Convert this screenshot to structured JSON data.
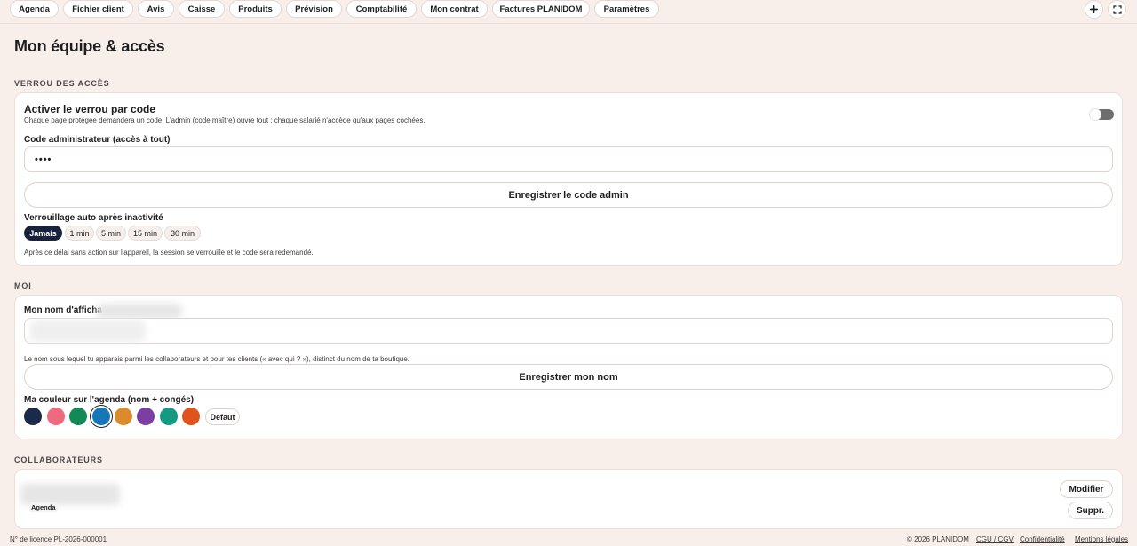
{
  "nav": {
    "tabs": [
      "Agenda",
      "Fichier client",
      "Avis",
      "Caisse",
      "Produits",
      "Prévision",
      "Comptabilité",
      "Mon contrat",
      "Factures PLANIDOM",
      "Paramètres"
    ],
    "plus_icon": "plus-icon",
    "expand_icon": "expand-icon"
  },
  "page": {
    "title": "Mon équipe & accès"
  },
  "lock_section": {
    "label": "VERROU DES ACCÈS",
    "toggle_title": "Activer le verrou par code",
    "toggle_desc": "Chaque page protégée demandera un code. L'admin (code maître) ouvre tout ; chaque salarié n'accède qu'aux pages cochées.",
    "toggle_on": false,
    "admin_code_label": "Code administrateur (accès à tout)",
    "admin_code_value": "••••",
    "save_admin_button": "Enregistrer le code admin",
    "autolock_label": "Verrouillage auto après inactivité",
    "autolock_options": [
      "Jamais",
      "1 min",
      "5 min",
      "15 min",
      "30 min"
    ],
    "autolock_selected": "Jamais",
    "autolock_desc": "Après ce délai sans action sur l'appareil, la session se verrouille et le code sera redemandé."
  },
  "me_section": {
    "label": "MOI",
    "display_name_label": "Mon nom d'afficha",
    "display_name_desc": "Le nom sous lequel tu apparais parmi les collaborateurs et pour tes clients (« avec qui ? »), distinct du nom de ta boutique.",
    "save_name_button": "Enregistrer mon nom",
    "color_label": "Ma couleur sur l'agenda (nom + congés)",
    "colors": [
      "#1a2a48",
      "#f0697e",
      "#138a55",
      "#1576b8",
      "#d98b2e",
      "#7a3fa0",
      "#139a80",
      "#e0531d"
    ],
    "selected_color": "#1576b8",
    "default_button": "Défaut"
  },
  "collab_section": {
    "label": "COLLABORATEURS",
    "collaborator_tag": "Agenda",
    "edit_button": "Modifier",
    "delete_button": "Suppr."
  },
  "footer": {
    "license": "N° de licence PL-2026-000001",
    "copyright": "© 2026 PLANIDOM",
    "links": [
      "CGU / CGV",
      "Confidentialité",
      "Mentions légales"
    ]
  }
}
